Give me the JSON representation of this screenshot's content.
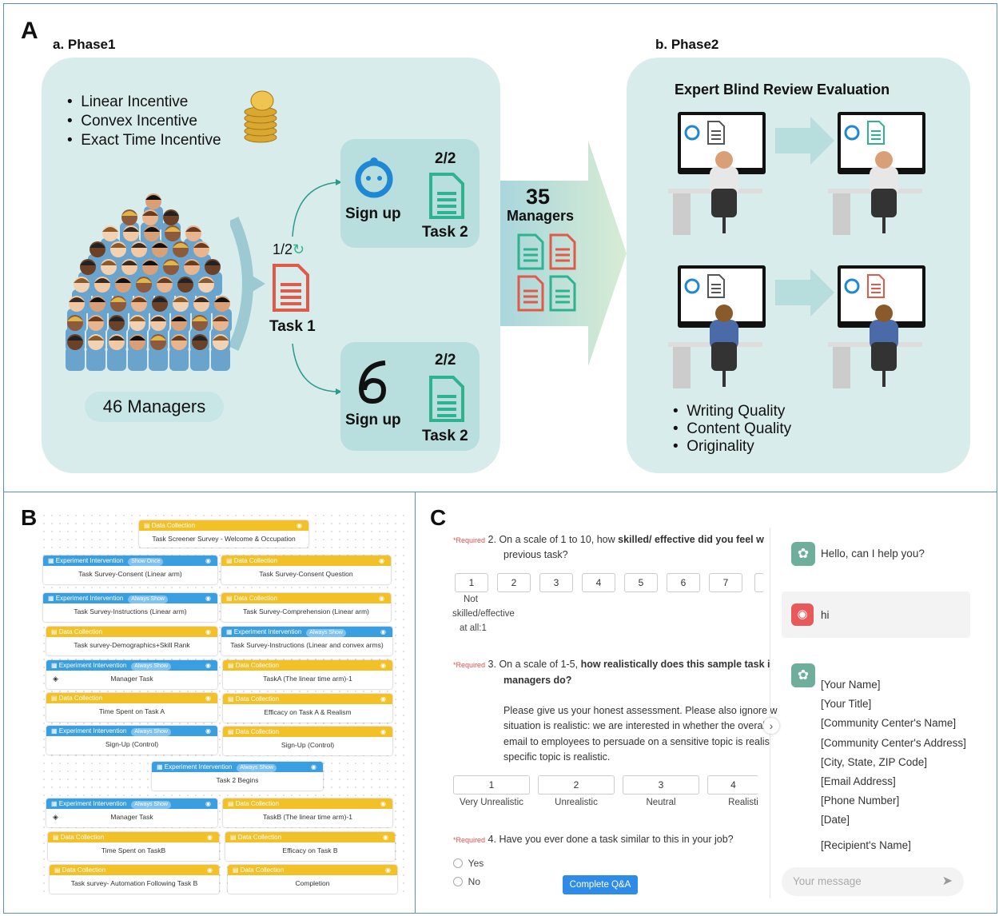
{
  "panel_a": {
    "letter": "A",
    "phase1_title": "a. Phase1",
    "phase2_title": "b. Phase2",
    "incentives": [
      "Linear Incentive",
      "Convex Incentive",
      "Exact Time Incentive"
    ],
    "managers_total": "46 Managers",
    "task1_fraction": "1/2",
    "task1_label": "Task 1",
    "branch_top": {
      "signup": "Sign up",
      "fraction": "2/2",
      "task": "Task 2"
    },
    "branch_bottom": {
      "signup": "Sign up",
      "fraction": "2/2",
      "task": "Task 2"
    },
    "arrow_count": "35",
    "arrow_label": "Managers",
    "phase2_heading": "Expert Blind Review Evaluation",
    "criteria": [
      "Writing Quality",
      "Content Quality",
      "Originality"
    ],
    "colors": {
      "panel": "#d8ecec",
      "card": "#b9dede",
      "teal": "#2db38f",
      "red": "#e05a4a"
    }
  },
  "panel_b": {
    "letter": "B",
    "nodes": [
      {
        "type": "Data Collection",
        "badge": "",
        "text": "Task Screener Survey - Welcome & Occupation"
      },
      {
        "type": "Experiment Intervention",
        "badge": "Show Once",
        "text": "Task Survey-Consent (Linear arm)"
      },
      {
        "type": "Data Collection",
        "badge": "",
        "text": "Task Survey-Consent Question"
      },
      {
        "type": "Experiment Intervention",
        "badge": "Always Show",
        "text": "Task Survey-Instructions (Linear arm)"
      },
      {
        "type": "Data Collection",
        "badge": "",
        "text": "Task Survey-Comprehension (Linear arm)"
      },
      {
        "type": "Data Collection",
        "badge": "",
        "text": "Task survey-Demographics+Skill Rank"
      },
      {
        "type": "Experiment Intervention",
        "badge": "Always Show",
        "text": "Task Survey-Instructions (Linear and convex arms)"
      },
      {
        "type": "Experiment Intervention",
        "badge": "Always Show",
        "text": "Manager Task"
      },
      {
        "type": "Data Collection",
        "badge": "",
        "text": "TaskA (The linear time arm)-1"
      },
      {
        "type": "Data Collection",
        "badge": "",
        "text": "Time Spent on Task A"
      },
      {
        "type": "Data Collection",
        "badge": "",
        "text": "Efficacy on Task A & Realism"
      },
      {
        "type": "Experiment Intervention",
        "badge": "Always Show",
        "text": "Sign-Up (Control)"
      },
      {
        "type": "Data Collection",
        "badge": "",
        "text": "Sign-Up (Control)"
      },
      {
        "type": "Experiment Intervention",
        "badge": "Always Show",
        "text": "Task 2 Begins"
      },
      {
        "type": "Experiment Intervention",
        "badge": "Always Show",
        "text": "Manager Task"
      },
      {
        "type": "Data Collection",
        "badge": "",
        "text": "TaskB (The linear time arm)-1"
      },
      {
        "type": "Data Collection",
        "badge": "",
        "text": "Time Spent on TaskB"
      },
      {
        "type": "Data Collection",
        "badge": "",
        "text": "Efficacy on Task B"
      },
      {
        "type": "Data Collection",
        "badge": "",
        "text": "Task survey- Automation Following Task B"
      },
      {
        "type": "Data Collection",
        "badge": "",
        "text": "Completion"
      }
    ]
  },
  "panel_c": {
    "letter": "C",
    "required": "*Required",
    "q2_num": "2.",
    "q2_pre": "On a scale of 1 to 10, how ",
    "q2_bold": "skilled/ effective did you feel w",
    "q2_line2": "previous task?",
    "q2_options": [
      "1",
      "2",
      "3",
      "4",
      "5",
      "6",
      "7"
    ],
    "q2_anchor": [
      "Not",
      "skilled/effective",
      "at all:1"
    ],
    "q3_num": "3.",
    "q3_pre": "On a scale of 1-5, ",
    "q3_bold": "how realistically does this sample task i",
    "q3_bold2": "managers do?",
    "q3_body": [
      "Please give us your honest assessment. Please also ignore w",
      "situation is realistic: we are interested in whether the overall",
      "email to employees to persuade on a sensitive topic is realis",
      "specific topic is realistic."
    ],
    "q3_options": [
      "1",
      "2",
      "3",
      "4"
    ],
    "q3_labels": [
      "Very Unrealistic",
      "Unrealistic",
      "Neutral",
      "Realisti"
    ],
    "q4_num": "4.",
    "q4_text": "Have you ever done a task similar to this in your job?",
    "q4_options": [
      "Yes",
      "No"
    ],
    "submit": "Complete Q&A",
    "chat_greeting": "Hello, can I help you?",
    "chat_user": "hi",
    "chat_reply": [
      "[Your Name]",
      "[Your Title]",
      "[Community Center's Name]",
      "[Community Center's Address]",
      "[City, State, ZIP Code]",
      "[Email Address]",
      "[Phone Number]",
      "[Date]",
      "[Recipient's Name]"
    ],
    "chat_placeholder": "Your message"
  }
}
